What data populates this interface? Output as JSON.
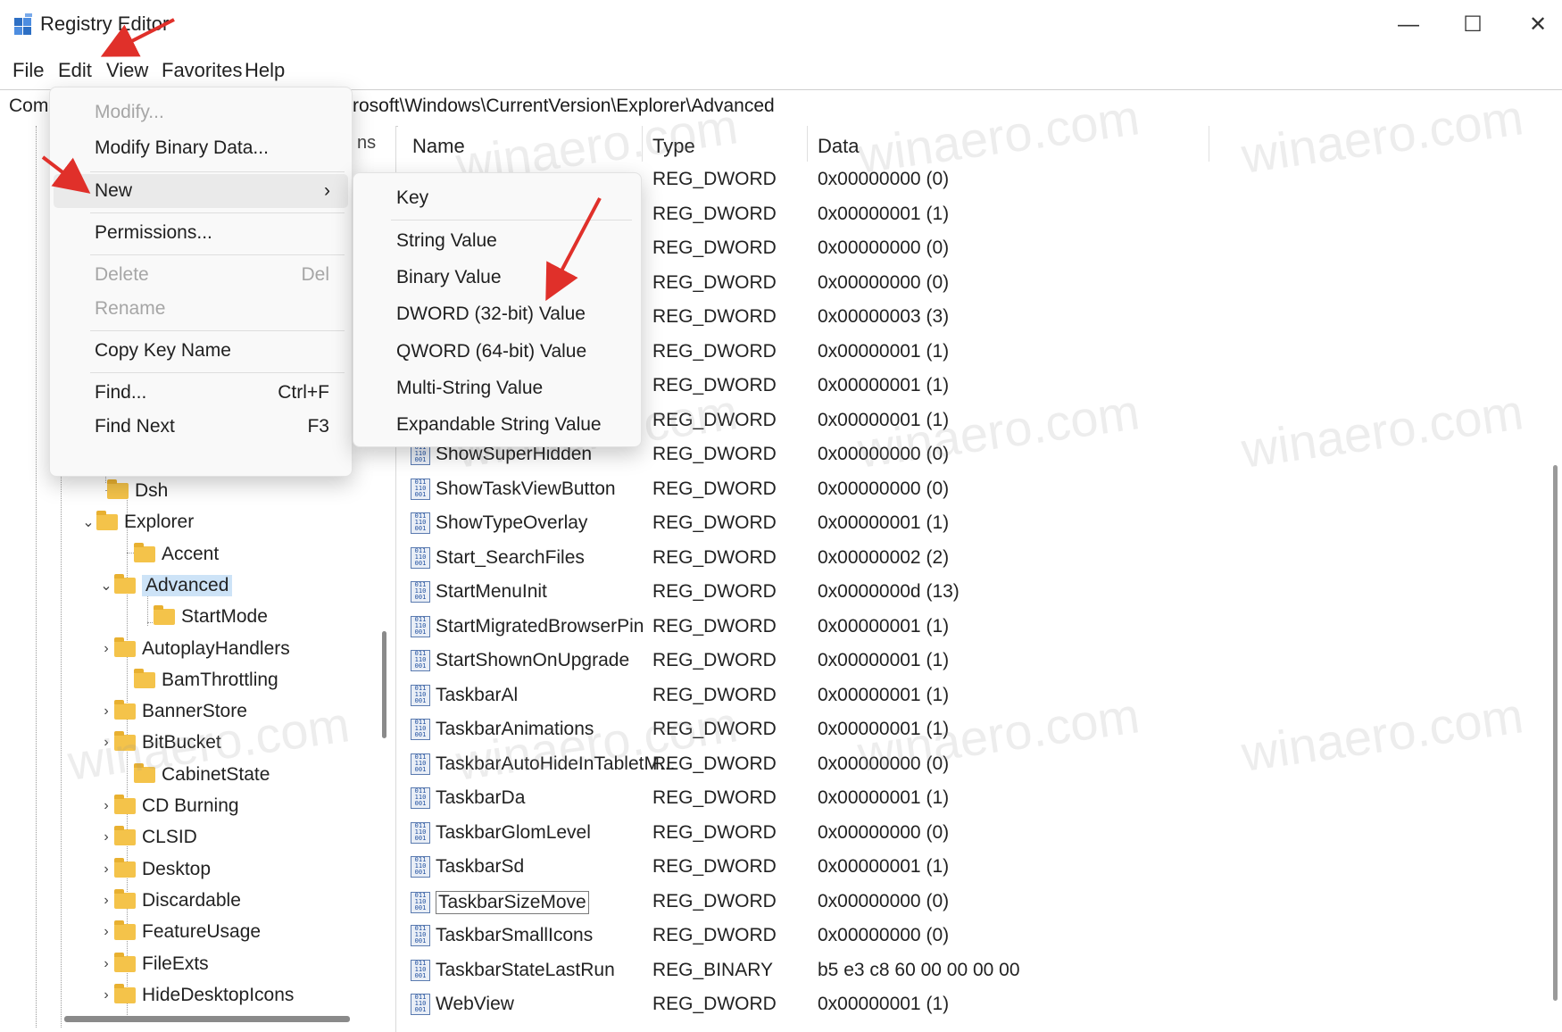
{
  "window": {
    "title": "Registry Editor",
    "controls": {
      "minimize": "—",
      "maximize": "☐",
      "close": "✕"
    }
  },
  "menubar": {
    "items": [
      "File",
      "Edit",
      "View",
      "Favorites",
      "Help"
    ]
  },
  "address": {
    "path": "Computer\\HKEY_CURRENT_USER\\Software\\Microsoft\\Windows\\CurrentVersion\\Explorer\\Advanced",
    "visible_prefix": "Comp",
    "visible_suffix": "rosoft\\Windows\\CurrentVersion\\Explorer\\Advanced"
  },
  "edit_menu": {
    "items": [
      {
        "label": "Modify...",
        "disabled": true
      },
      {
        "label": "Modify Binary Data...",
        "disabled": false
      },
      {
        "label": "New",
        "submenu": "›"
      },
      {
        "label": "Permissions...",
        "disabled": false
      },
      {
        "label": "Delete",
        "shortcut": "Del",
        "disabled": true
      },
      {
        "label": "Rename",
        "disabled": true
      },
      {
        "label": "Copy Key Name",
        "disabled": false
      },
      {
        "label": "Find...",
        "shortcut": "Ctrl+F",
        "disabled": false
      },
      {
        "label": "Find Next",
        "shortcut": "F3",
        "disabled": false
      }
    ]
  },
  "new_submenu": {
    "items": [
      "Key",
      "String Value",
      "Binary Value",
      "DWORD (32-bit) Value",
      "QWORD (64-bit) Value",
      "Multi-String Value",
      "Expandable String Value"
    ]
  },
  "tree": {
    "partial_header": "ns",
    "items": [
      {
        "label": "Dsh",
        "chevron": ""
      },
      {
        "label": "Explorer",
        "chevron": "⌄"
      },
      {
        "label": "Accent",
        "chevron": ""
      },
      {
        "label": "Advanced",
        "chevron": "⌄",
        "selected": true
      },
      {
        "label": "StartMode",
        "chevron": ""
      },
      {
        "label": "AutoplayHandlers",
        "chevron": "›"
      },
      {
        "label": "BamThrottling",
        "chevron": ""
      },
      {
        "label": "BannerStore",
        "chevron": "›"
      },
      {
        "label": "BitBucket",
        "chevron": "›"
      },
      {
        "label": "CabinetState",
        "chevron": ""
      },
      {
        "label": "CD Burning",
        "chevron": "›"
      },
      {
        "label": "CLSID",
        "chevron": "›"
      },
      {
        "label": "Desktop",
        "chevron": "›"
      },
      {
        "label": "Discardable",
        "chevron": "›"
      },
      {
        "label": "FeatureUsage",
        "chevron": "›"
      },
      {
        "label": "FileExts",
        "chevron": "›"
      },
      {
        "label": "HideDesktopIcons",
        "chevron": "›"
      }
    ]
  },
  "list": {
    "columns": {
      "name": "Name",
      "type": "Type",
      "data": "Data"
    },
    "rows": [
      {
        "name": "",
        "type": "REG_DWORD",
        "data": "0x00000000 (0)"
      },
      {
        "name": "",
        "type": "REG_DWORD",
        "data": "0x00000001 (1)"
      },
      {
        "name": "",
        "type": "REG_DWORD",
        "data": "0x00000000 (0)"
      },
      {
        "name": "",
        "type": "REG_DWORD",
        "data": "0x00000000 (0)"
      },
      {
        "name": "",
        "type": "REG_DWORD",
        "data": "0x00000003 (3)"
      },
      {
        "name": "",
        "type": "REG_DWORD",
        "data": "0x00000001 (1)"
      },
      {
        "name": "",
        "type": "REG_DWORD",
        "data": "0x00000001 (1)"
      },
      {
        "name": "",
        "type": "REG_DWORD",
        "data": "0x00000001 (1)"
      },
      {
        "name": "ShowSuperHidden",
        "type": "REG_DWORD",
        "data": "0x00000000 (0)"
      },
      {
        "name": "ShowTaskViewButton",
        "type": "REG_DWORD",
        "data": "0x00000000 (0)"
      },
      {
        "name": "ShowTypeOverlay",
        "type": "REG_DWORD",
        "data": "0x00000001 (1)"
      },
      {
        "name": "Start_SearchFiles",
        "type": "REG_DWORD",
        "data": "0x00000002 (2)"
      },
      {
        "name": "StartMenuInit",
        "type": "REG_DWORD",
        "data": "0x0000000d (13)"
      },
      {
        "name": "StartMigratedBrowserPin",
        "type": "REG_DWORD",
        "data": "0x00000001 (1)"
      },
      {
        "name": "StartShownOnUpgrade",
        "type": "REG_DWORD",
        "data": "0x00000001 (1)"
      },
      {
        "name": "TaskbarAl",
        "type": "REG_DWORD",
        "data": "0x00000001 (1)"
      },
      {
        "name": "TaskbarAnimations",
        "type": "REG_DWORD",
        "data": "0x00000001 (1)"
      },
      {
        "name": "TaskbarAutoHideInTabletM...",
        "type": "REG_DWORD",
        "data": "0x00000000 (0)"
      },
      {
        "name": "TaskbarDa",
        "type": "REG_DWORD",
        "data": "0x00000001 (1)"
      },
      {
        "name": "TaskbarGlomLevel",
        "type": "REG_DWORD",
        "data": "0x00000000 (0)"
      },
      {
        "name": "TaskbarSd",
        "type": "REG_DWORD",
        "data": "0x00000001 (1)"
      },
      {
        "name": "TaskbarSizeMove",
        "type": "REG_DWORD",
        "data": "0x00000000 (0)",
        "focused": true
      },
      {
        "name": "TaskbarSmallIcons",
        "type": "REG_DWORD",
        "data": "0x00000000 (0)"
      },
      {
        "name": "TaskbarStateLastRun",
        "type": "REG_BINARY",
        "data": "b5 e3 c8 60 00 00 00 00"
      },
      {
        "name": "WebView",
        "type": "REG_DWORD",
        "data": "0x00000001 (1)"
      }
    ]
  },
  "watermark": {
    "text": "winaero.com"
  },
  "colors": {
    "arrow": "#e0302a",
    "selection": "#cde3f7",
    "folder": "#f4c34a",
    "menu_bg": "#f9f9f9"
  },
  "icons": {
    "app": "registry-editor-icon",
    "value": "reg-dword-icon",
    "folder": "folder-icon"
  }
}
